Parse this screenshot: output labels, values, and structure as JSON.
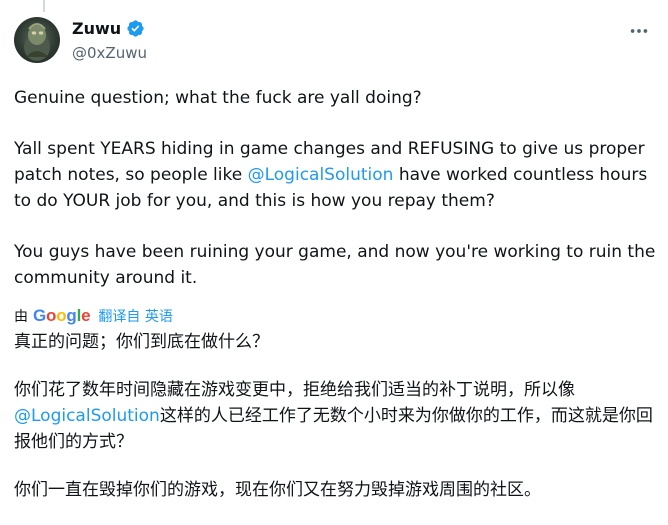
{
  "author": {
    "display_name": "Zuwu",
    "handle": "@0xZuwu"
  },
  "tweet": {
    "p1": "Genuine question; what the fuck are yall doing?",
    "p2_before": "Yall spent YEARS hiding in game changes and REFUSING to give us proper patch notes, so people like ",
    "p2_mention": "@LogicalSolution",
    "p2_after": " have worked countless hours to do YOUR job for you, and this is how you repay them?",
    "p3": "You guys have been ruining your game, and now you're working to ruin the community around it."
  },
  "translation": {
    "by_label": "由",
    "google_letters": [
      "G",
      "o",
      "o",
      "g",
      "l",
      "e"
    ],
    "link_label": "翻译自 英语",
    "p1": "真正的问题；你们到底在做什么？",
    "p2_before": "你们花了数年时间隐藏在游戏变更中，拒绝给我们适当的补丁说明，所以像",
    "p2_mention": "@LogicalSolution",
    "p2_after": "这样的人已经工作了无数个小时来为你做你的工作，而这就是你回报他们的方式？",
    "p3": "你们一直在毁掉你们的游戏，现在你们又在努力毁掉游戏周围的社区。"
  },
  "icons": {
    "verified": "verified-badge-icon",
    "more": "more-options-icon"
  },
  "colors": {
    "link": "#1d9bf0",
    "text": "#0f1419",
    "muted": "#536471",
    "google_blue": "#4285f4",
    "google_red": "#ea4335",
    "google_yellow": "#fbbc05",
    "google_green": "#34a853"
  }
}
